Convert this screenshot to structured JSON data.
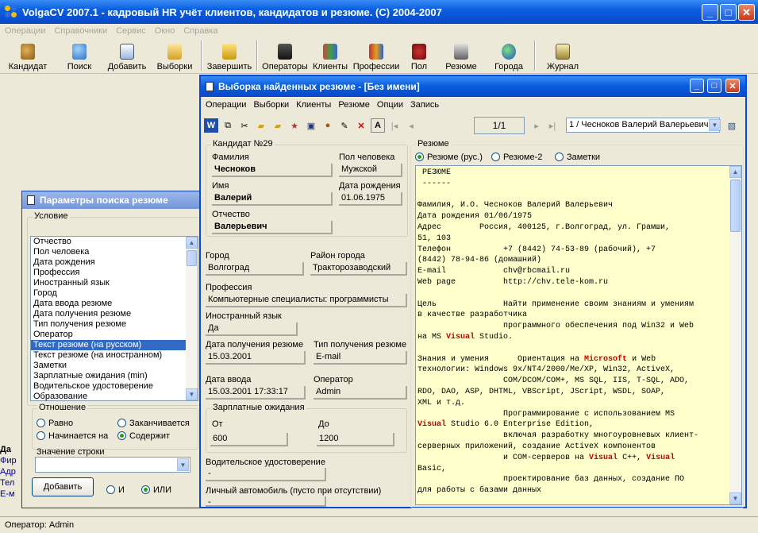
{
  "app": {
    "title": "VolgaCV 2007.1 - кадровый HR учёт клиентов, кандидатов и резюме. (C) 2004-2007",
    "menu": [
      "Операции",
      "Справочники",
      "Сервис",
      "Окно",
      "Справка"
    ],
    "toolbar": [
      "Кандидат",
      "Поиск",
      "Добавить",
      "Выборки",
      "Завершить",
      "Операторы",
      "Клиенты",
      "Профессии",
      "Пол",
      "Резюме",
      "Города",
      "Журнал"
    ],
    "status": "Оператор: Admin",
    "left_fragments": [
      "Да",
      "Фир",
      "Адр",
      "Тел",
      "E-м"
    ]
  },
  "search": {
    "title": "Параметры поиска резюме",
    "condition_label": "Условие",
    "items": [
      "Отчество",
      "Пол человека",
      "Дата рождения",
      "Профессия",
      "Иностранный язык",
      "Город",
      "Дата ввода резюме",
      "Дата получения резюме",
      "Тип получения резюме",
      "Оператор",
      "Текст резюме (на русском)",
      "Текст резюме (на иностранном)",
      "Заметки",
      "Зарплатные ожидания (min)",
      "Водительское удостоверение",
      "Образование"
    ],
    "selected_index": 10,
    "relation_label": "Отношение",
    "rel": [
      "Равно",
      "Заканчивается",
      "Начинается на",
      "Содержит"
    ],
    "value_label": "Значение строки",
    "add": "Добавить",
    "and": "И",
    "or": "ИЛИ"
  },
  "result": {
    "title": "Выборка найденных резюме - [Без имени]",
    "menu": [
      "Операции",
      "Выборки",
      "Клиенты",
      "Резюме",
      "Опции",
      "Запись"
    ],
    "page": "1/1",
    "record": "1 / Чесноков Валерий Валерьевич",
    "candidate_label": "Кандидат №29",
    "fam_l": "Фамилия",
    "fam": "Чесноков",
    "sex_l": "Пол человека",
    "sex": "Мужской",
    "name_l": "Имя",
    "name": "Валерий",
    "dob_l": "Дата рождения",
    "dob": "01.06.1975",
    "pat_l": "Отчество",
    "pat": "Валерьевич",
    "city_l": "Город",
    "city": "Волгоград",
    "district_l": "Район города",
    "district": "Тракторозаводский",
    "prof_l": "Профессия",
    "prof": "Компьютерные специалисты: программисты",
    "lang_l": "Иностранный язык",
    "lang": "Да",
    "recv_l": "Дата получения резюме",
    "recv": "15.03.2001",
    "rtype_l": "Тип получения резюме",
    "rtype": "E-mail",
    "entry_l": "Дата ввода",
    "entry": "15.03.2001 17:33:17",
    "op_l": "Оператор",
    "op": "Admin",
    "salary_l": "Зарплатные ожидания",
    "from_l": "От",
    "from": "600",
    "to_l": "До",
    "to": "1200",
    "drv_l": "Водительское удостоверение",
    "drv": "-",
    "car_l": "Личный автомобиль (пусто при отсутствии)",
    "car": "-",
    "resume_label": "Резюме",
    "tabs": [
      "Резюме (рус.)",
      "Резюме-2",
      "Заметки"
    ]
  },
  "resume_lines": [
    [
      " РЕЗЮМЕ"
    ],
    [
      " ------"
    ],
    [
      ""
    ],
    [
      "Фамилия, И.О. Чесноков Валерий Валерьевич"
    ],
    [
      "Дата рождения 01/06/1975"
    ],
    [
      "Адрес        Россия, 400125, г.Волгоград, ул. Грамши,"
    ],
    [
      "51, 103"
    ],
    [
      "Телефон           +7 (8442) 74-53-89 (рабочий), +7"
    ],
    [
      "(8442) 78-94-86 (домашний)"
    ],
    [
      "E-mail            chv@rbcmail.ru"
    ],
    [
      "Web page          http://chv.tele-kom.ru"
    ],
    [
      ""
    ],
    [
      "Цель              Найти применение своим знаниям и умениям"
    ],
    [
      "в качестве разработчика"
    ],
    [
      "                  программного обеспечения под Win32 и Web"
    ],
    [
      "на MS ",
      "Visual",
      " Studio."
    ],
    [
      ""
    ],
    [
      "Знания и умения      Ориентация на ",
      "Microsoft",
      " и Web"
    ],
    [
      "технологии: Windows 9x/NT4/2000/Me/XP, Win32, ActiveX,"
    ],
    [
      "                  COM/DCOM/COM+, MS SQL, IIS, T-SQL, ADO,"
    ],
    [
      "RDO, DAO, ASP, DHTML, VBScript, JScript, WSDL, SOAP,"
    ],
    [
      "XML и т.д."
    ],
    [
      "                  Программирование с использованием MS"
    ],
    [
      "",
      "Visual",
      " Studio 6.0 Enterprise Edition,"
    ],
    [
      "                  включая разработку многоуровневых клиент-"
    ],
    [
      "серверных приложений, создание ActiveX компонентов"
    ],
    [
      "                  и COM-серверов на ",
      "Visual",
      " C++, ",
      "Visual"
    ],
    [
      "Basic,"
    ],
    [
      "                  проектирование баз данных, создание ПО"
    ],
    [
      "для работы с базами данных"
    ]
  ],
  "colors": {
    "title_blue": "#0a5fe0",
    "highlight": "#c00",
    "resume_bg": "#ffffcc",
    "selection": "#316ac5"
  }
}
